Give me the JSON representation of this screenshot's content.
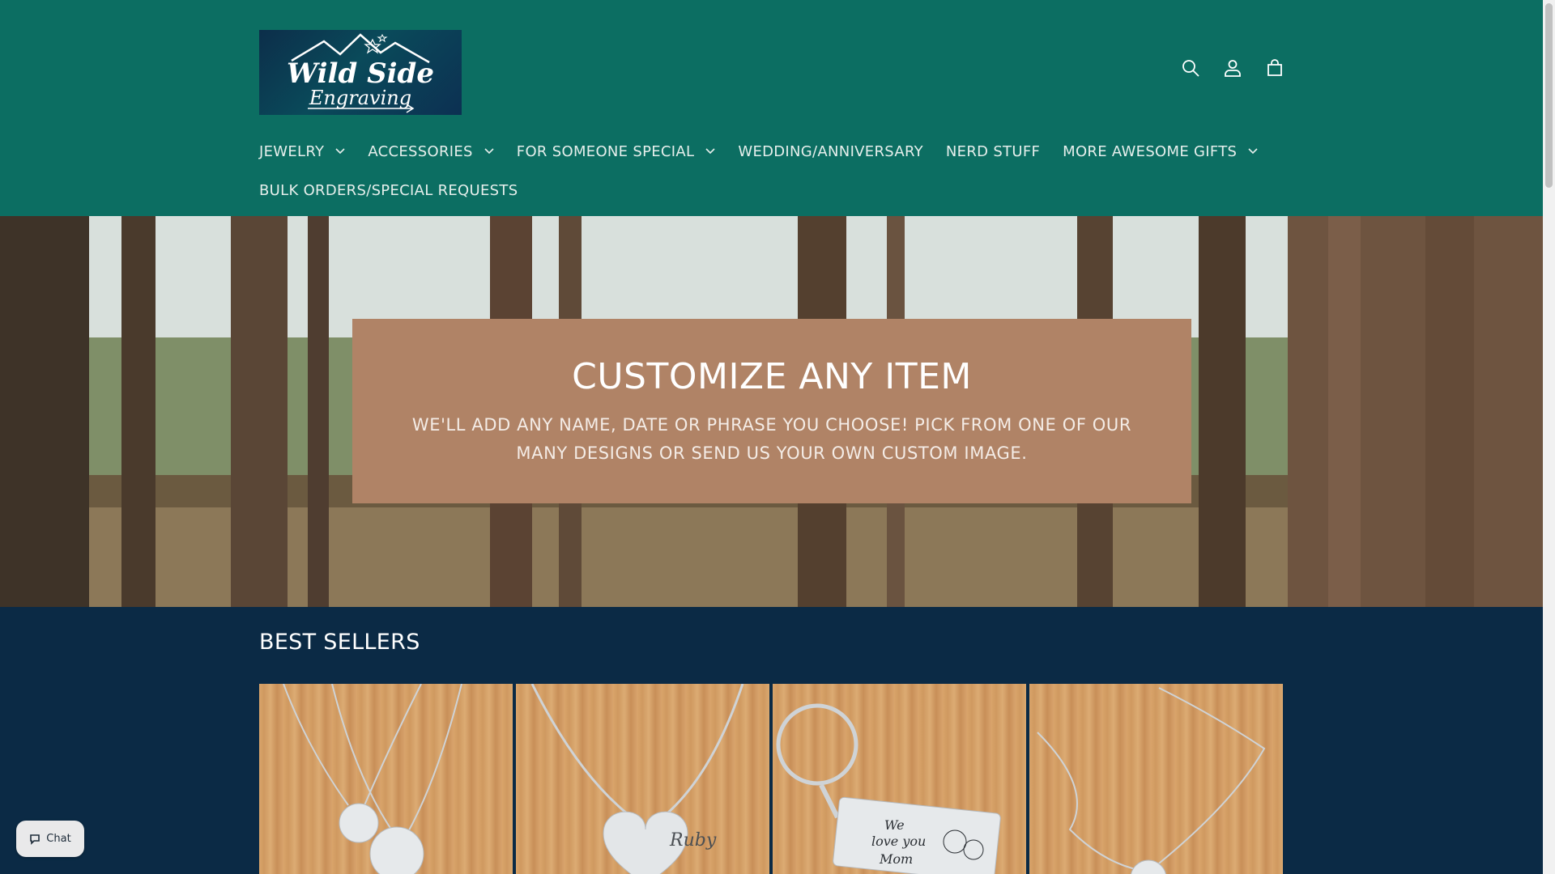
{
  "header": {
    "logo": {
      "line1": "Wild Side",
      "line2": "Engraving"
    },
    "icons": [
      "search-icon",
      "account-icon",
      "cart-icon"
    ]
  },
  "nav": {
    "items": [
      {
        "label": "JEWELRY",
        "dropdown": true
      },
      {
        "label": "ACCESSORIES",
        "dropdown": true
      },
      {
        "label": "FOR SOMEONE SPECIAL",
        "dropdown": true
      },
      {
        "label": "WEDDING/ANNIVERSARY",
        "dropdown": false
      },
      {
        "label": "NERD STUFF",
        "dropdown": false
      },
      {
        "label": "MORE AWESOME GIFTS",
        "dropdown": true
      },
      {
        "label": "BULK ORDERS/SPECIAL REQUESTS",
        "dropdown": false
      }
    ]
  },
  "hero": {
    "title": "CUSTOMIZE ANY ITEM",
    "subtitle": "WE'LL ADD ANY NAME, DATE OR PHRASE YOU CHOOSE! PICK FROM ONE OF OUR MANY DESIGNS OR SEND US YOUR OWN CUSTOM IMAGE."
  },
  "best_sellers": {
    "title": "BEST SELLERS",
    "products": [
      {
        "image": "two-disc-flower-necklace"
      },
      {
        "image": "heart-flower-name-necklace",
        "engraving": "Ruby"
      },
      {
        "image": "we-love-you-mom-keychain",
        "engraving_line1": "We",
        "engraving_line2": "love you",
        "engraving_line3": "Mom"
      },
      {
        "image": "disc-pendant-chain-necklace"
      }
    ]
  },
  "chat": {
    "label": "Chat"
  },
  "colors": {
    "header_bg": "#0c6e62",
    "hero_box": "#b08366",
    "section_bg": "#0b2a45"
  }
}
